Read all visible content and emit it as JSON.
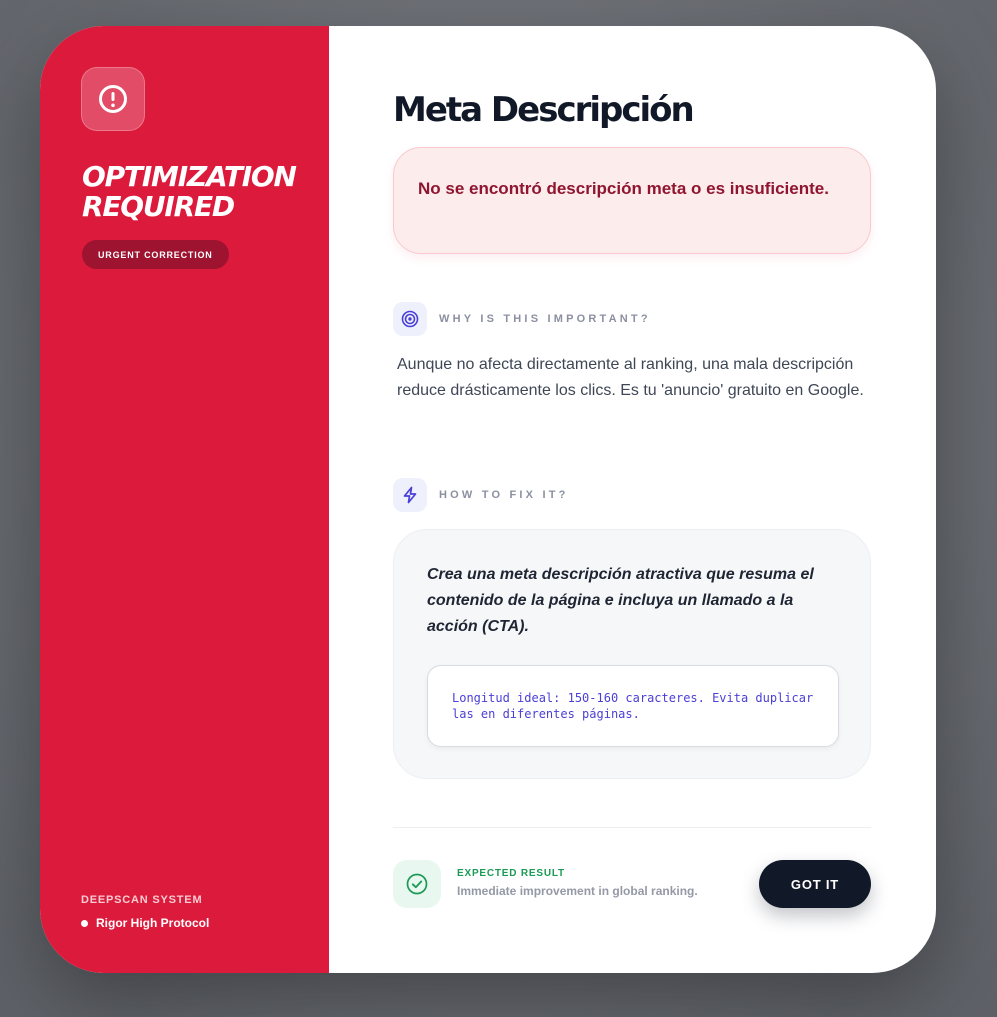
{
  "sidebar": {
    "title_line1": "OPTIMIZATION",
    "title_line2": "REQUIRED",
    "badge": "URGENT CORRECTION",
    "system_label": "DEEPSCAN SYSTEM",
    "protocol": "Rigor High Protocol",
    "icon": "alert-circle-icon"
  },
  "header": {
    "title": "Meta Descripción",
    "close_icon": "close-icon"
  },
  "issue": {
    "message": "No se encontró descripción meta o es insuficiente."
  },
  "why": {
    "label": "WHY IS THIS IMPORTANT?",
    "icon": "target-icon",
    "text": "Aunque no afecta directamente al ranking, una mala descripción reduce drásticamente los clics. Es tu 'anuncio' gratuito en Google."
  },
  "fix": {
    "label": "HOW TO FIX IT?",
    "icon": "lightning-icon",
    "text": "Crea una meta descripción atractiva que resuma el contenido de la página e incluya un llamado a la acción (CTA).",
    "code": "Longitud ideal: 150-160 caracteres. Evita duplicarlas en diferentes páginas."
  },
  "footer": {
    "result_label": "EXPECTED RESULT",
    "result_desc": "Immediate improvement in global ranking.",
    "result_icon": "check-circle-icon",
    "button_label": "GOT IT"
  },
  "colors": {
    "accent_red": "#dc1a3c",
    "dark": "#111827",
    "success": "#1a9a55",
    "indigo": "#4b3fd6"
  }
}
